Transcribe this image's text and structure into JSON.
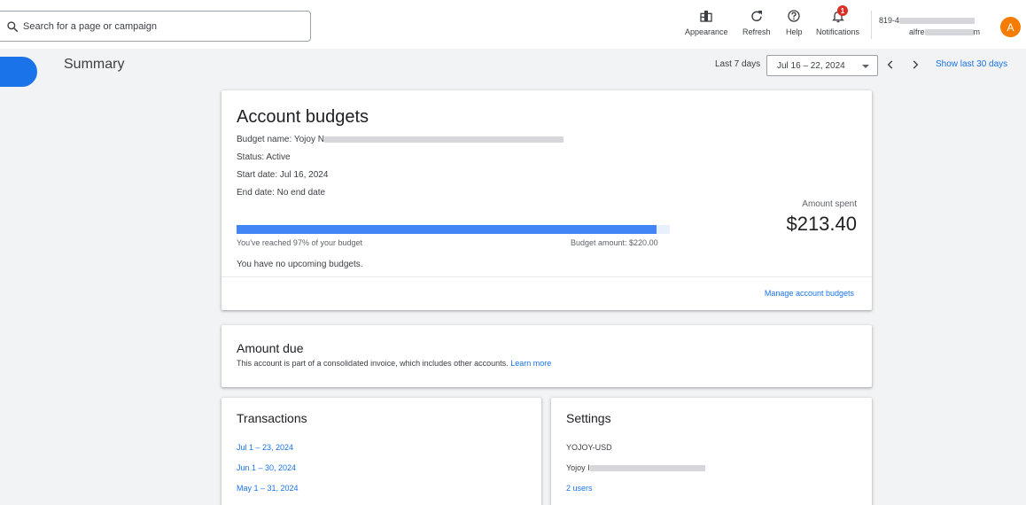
{
  "topbar": {
    "search_placeholder": "Search for a page or campaign",
    "tools": [
      {
        "icon": "appearance-icon",
        "label": "Appearance"
      },
      {
        "icon": "refresh-icon",
        "label": "Refresh"
      },
      {
        "icon": "help-icon",
        "label": "Help"
      },
      {
        "icon": "bell-icon",
        "label": "Notifications",
        "badge": "1"
      }
    ],
    "account_id_prefix": "819-4",
    "account_email_prefix": "alfre",
    "account_email_suffix": "m",
    "avatar_letter": "A"
  },
  "page": {
    "title": "Summary",
    "range_label": "Last 7 days",
    "date_range": "Jul 16 – 22, 2024",
    "show_last_link": "Show last 30 days"
  },
  "account_budgets": {
    "title": "Account budgets",
    "budget_name_label": "Budget name: Yojoy N",
    "status": "Status: Active",
    "start_date": "Start date: Jul 16, 2024",
    "end_date": "End date: No end date",
    "amount_spent_label": "Amount spent",
    "amount_spent": "$213.40",
    "progress_fraction": 0.97,
    "progress_text": "You've reached 97% of your budget",
    "budget_amount": "Budget amount: $220.00",
    "upcoming": "You have no upcoming budgets.",
    "manage_link": "Manage account budgets"
  },
  "amount_due": {
    "title": "Amount due",
    "text": "This account is part of a consolidated invoice, which includes other accounts.",
    "learn_more": "Learn more"
  },
  "transactions": {
    "title": "Transactions",
    "items": [
      "Jul 1 – 23, 2024",
      "Jun 1 – 30, 2024",
      "May 1 – 31, 2024"
    ]
  },
  "settings": {
    "title": "Settings",
    "account_code": "YOJOY-USD",
    "account_name_prefix": "Yojoy I",
    "users_link": "2 users"
  },
  "colors": {
    "accent": "#1a73e8",
    "progress": "#4285f4",
    "badge": "#d93025",
    "avatar": "#f57c00"
  }
}
